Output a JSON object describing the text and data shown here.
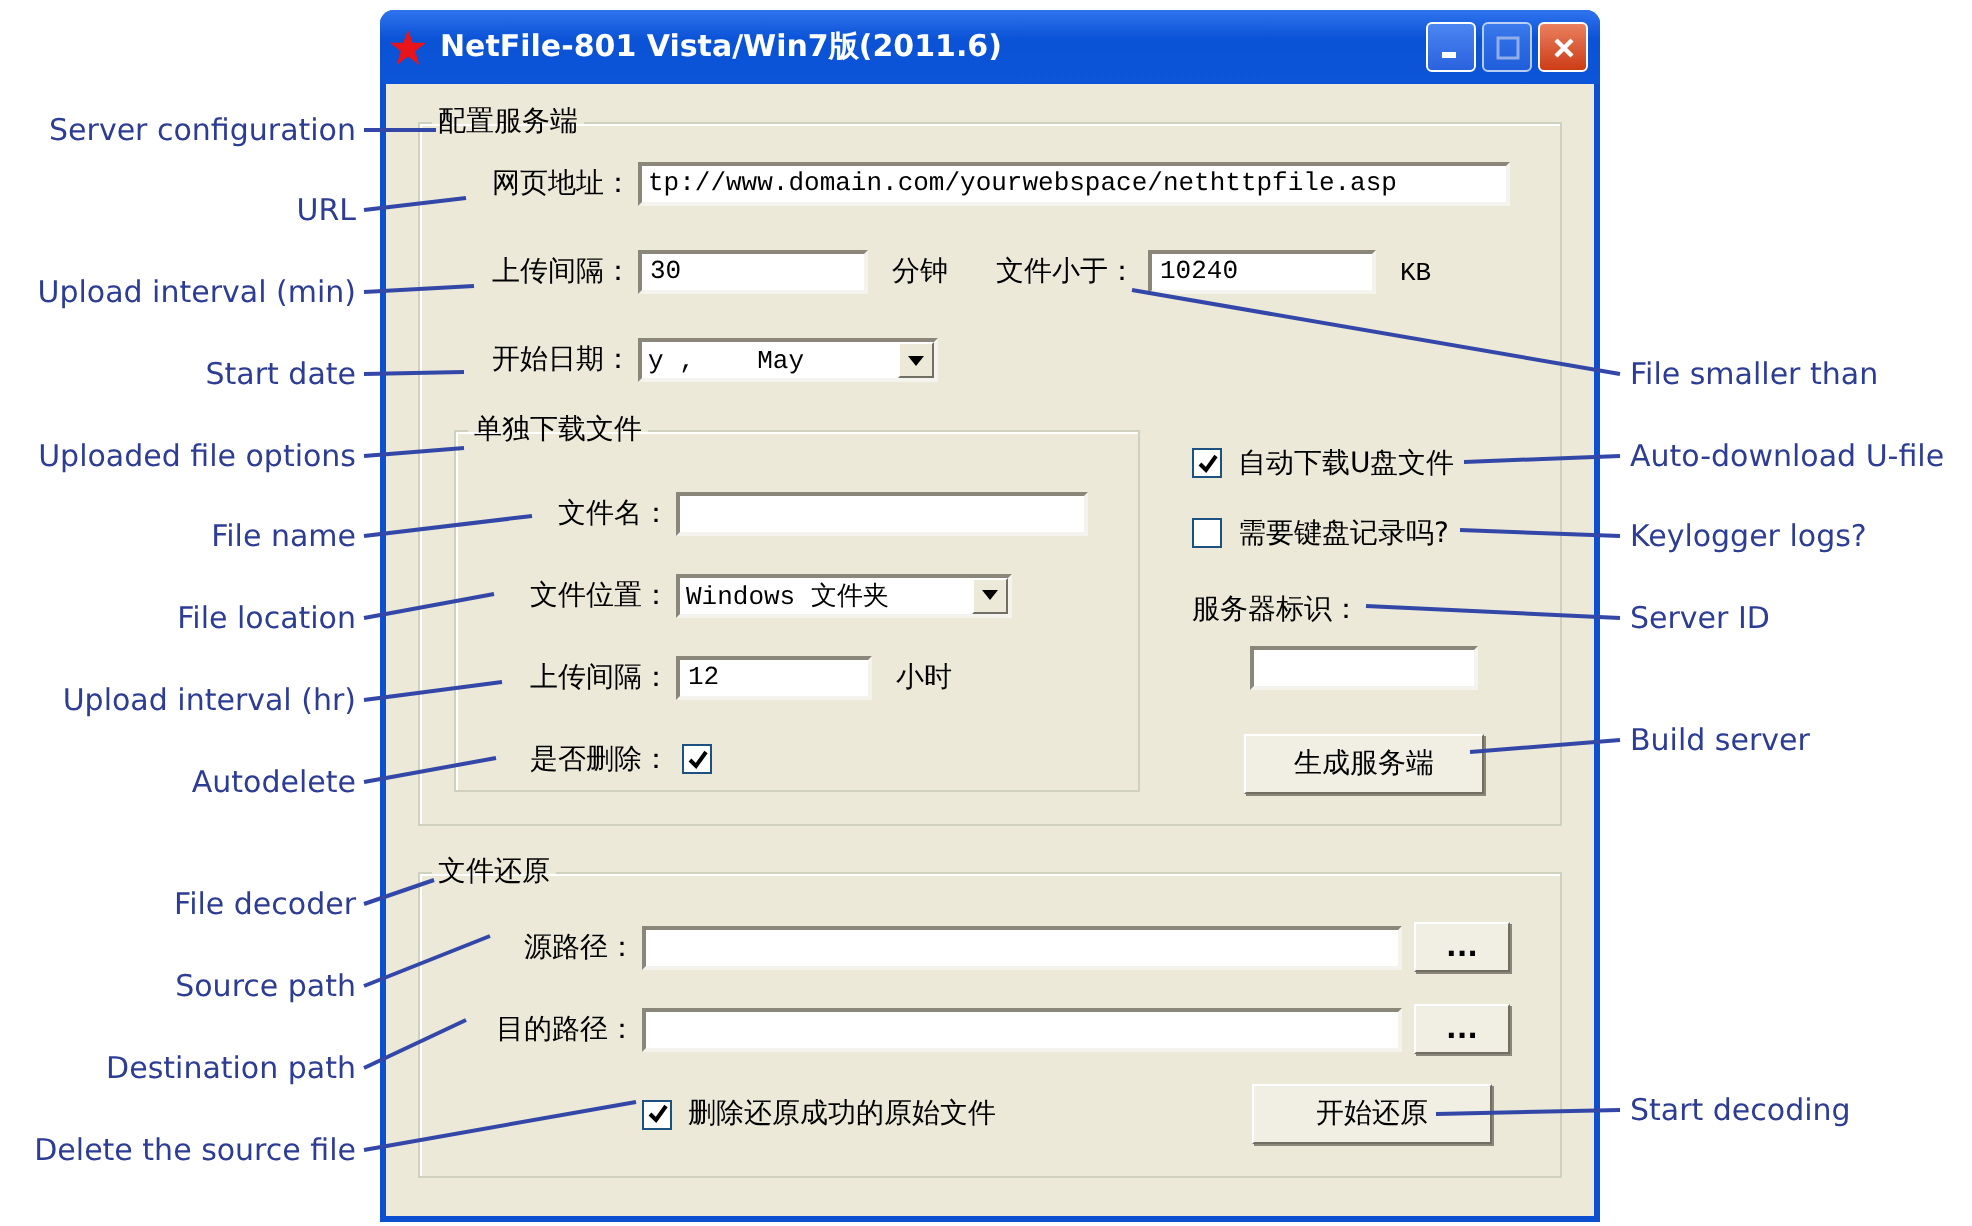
{
  "window": {
    "title": "NetFile-801 Vista/Win7版(2011.6)"
  },
  "server_config": {
    "legend": "配置服务端",
    "url": {
      "label": "网页地址：",
      "value": "tp://www.domain.com/yourwebspace/nethttpfile.asp"
    },
    "upload_interval": {
      "label": "上传间隔：",
      "value": "30",
      "unit": "分钟"
    },
    "file_size": {
      "label": "文件小于：",
      "value": "10240",
      "unit": "KB"
    },
    "start_date": {
      "label": "开始日期：",
      "value": "y ,    May"
    }
  },
  "uploaded_files": {
    "legend": "单独下载文件",
    "file_name": {
      "label": "文件名："
    },
    "file_location": {
      "label": "文件位置：",
      "value": "Windows 文件夹"
    },
    "upload_interval": {
      "label": "上传间隔：",
      "value": "12",
      "unit": "小时"
    },
    "autodelete": {
      "label": "是否删除：",
      "checked": true
    }
  },
  "options": [
    {
      "label": "自动下载U盘文件",
      "checked": true
    },
    {
      "label": "需要键盘记录吗?",
      "checked": false
    }
  ],
  "server_id": {
    "label": "服务器标识："
  },
  "build_button": "生成服务端",
  "file_decoder": {
    "legend": "文件还原",
    "paths": [
      {
        "label": "源路径：",
        "browse": "..."
      },
      {
        "label": "目的路径：",
        "browse": "..."
      }
    ],
    "delete_source": {
      "label": "删除还原成功的原始文件",
      "checked": true
    },
    "start_button": "开始还原"
  },
  "annotations_left": [
    "Server configuration",
    "URL",
    "Upload interval (min)",
    "Start date",
    "Uploaded file options",
    "File name",
    "File location",
    "Upload interval (hr)",
    "Autodelete",
    "File decoder",
    "Source path",
    "Destination path",
    "Delete the source file"
  ],
  "annotations_right": [
    "File smaller than",
    "Auto-download U-file",
    "Keylogger logs?",
    "Server ID",
    "Build server",
    "Start decoding"
  ]
}
